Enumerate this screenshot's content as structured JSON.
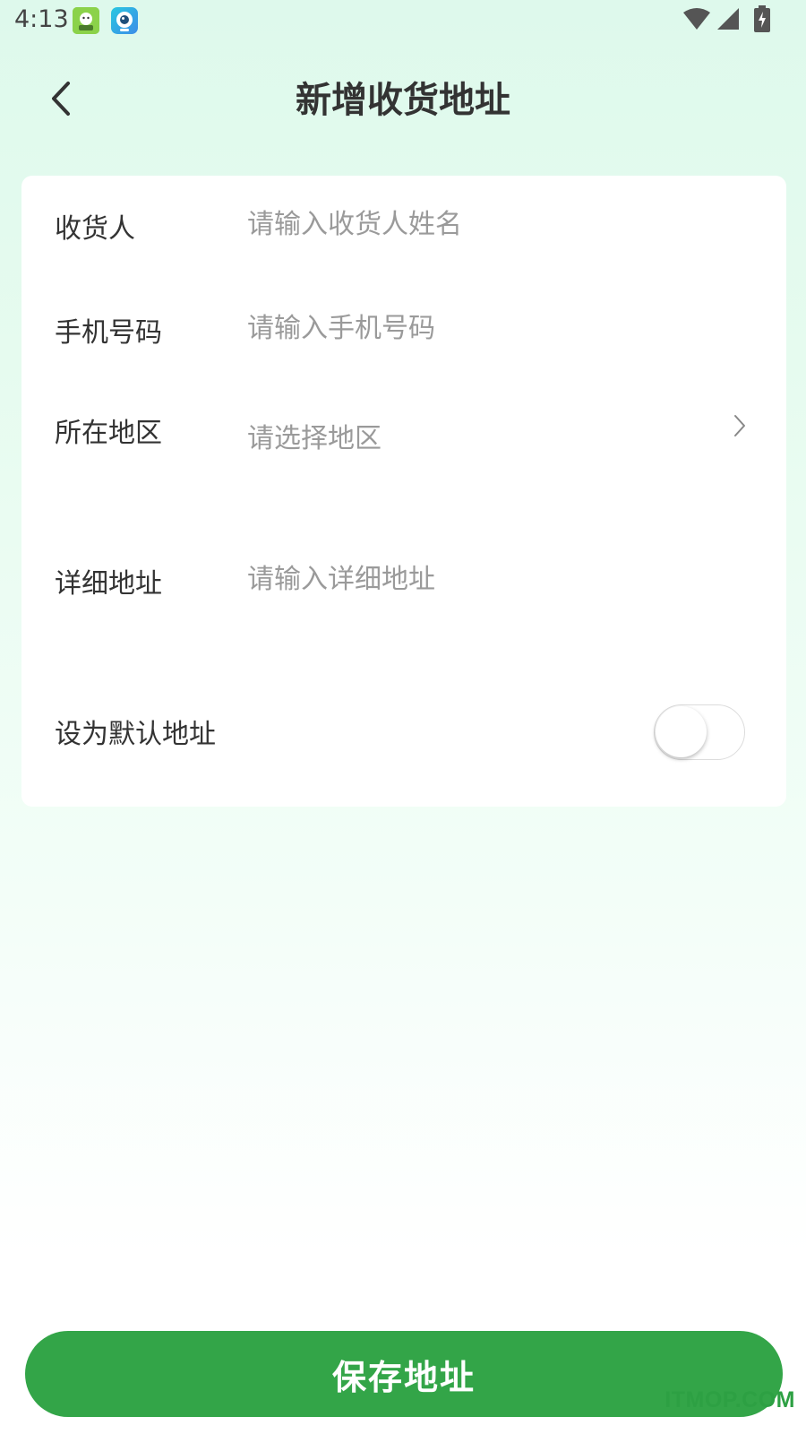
{
  "status_bar": {
    "time": "4:13",
    "icons": [
      "app-notification-icon",
      "app-camera-icon",
      "wifi-icon",
      "signal-icon",
      "battery-charging-icon"
    ]
  },
  "header": {
    "title": "新增收货地址",
    "back_icon": "chevron-left-icon"
  },
  "form": {
    "recipient": {
      "label": "收货人",
      "placeholder": "请输入收货人姓名",
      "value": ""
    },
    "phone": {
      "label": "手机号码",
      "placeholder": "请输入手机号码",
      "value": ""
    },
    "region": {
      "label": "所在地区",
      "placeholder": "请选择地区",
      "icon": "chevron-right-icon"
    },
    "detail": {
      "label": "详细地址",
      "placeholder": "请输入详细地址",
      "value": ""
    },
    "default_address": {
      "label": "设为默认地址",
      "enabled": false
    }
  },
  "save_button": {
    "label": "保存地址"
  },
  "watermark": "ITMOP.COM",
  "colors": {
    "accent": "#33a548",
    "background_top": "#def9ec",
    "card": "#ffffff",
    "label": "#333333",
    "placeholder": "#9a9a9a"
  }
}
